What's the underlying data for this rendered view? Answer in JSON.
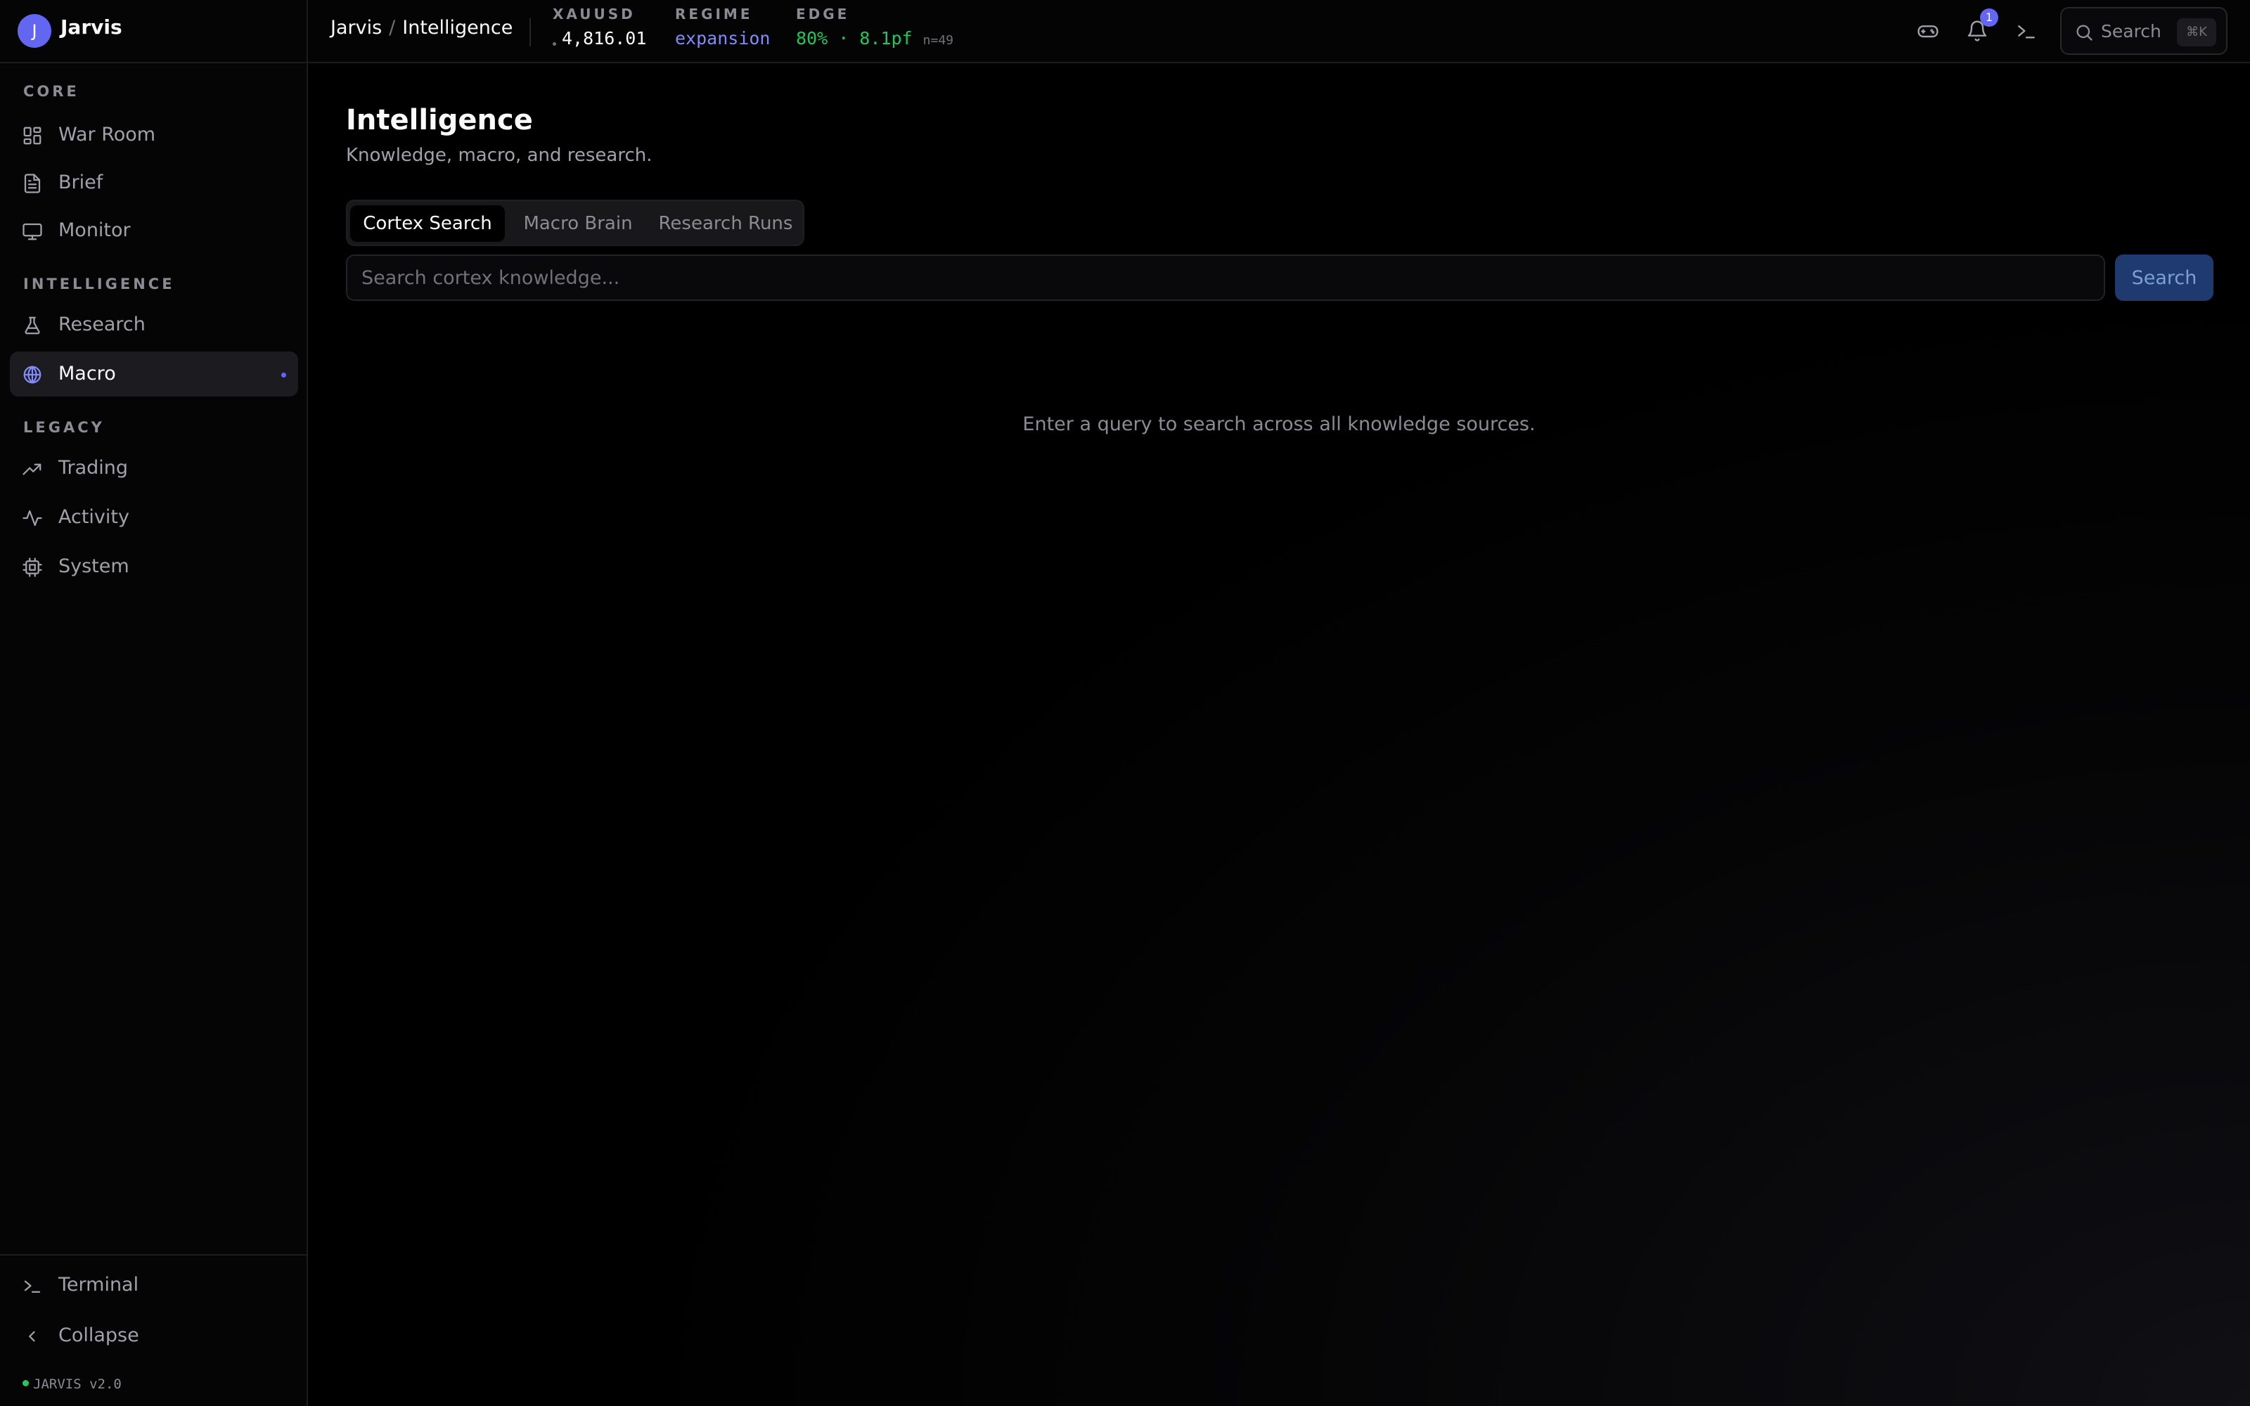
{
  "brand": {
    "avatar_letter": "J",
    "name": "Jarvis"
  },
  "sidebar": {
    "sections": {
      "core": "CORE",
      "intelligence": "INTELLIGENCE",
      "legacy": "LEGACY"
    },
    "items": [
      {
        "label": "War Room",
        "icon": "grid-icon"
      },
      {
        "label": "Brief",
        "icon": "document-icon"
      },
      {
        "label": "Monitor",
        "icon": "monitor-icon"
      },
      {
        "label": "Research",
        "icon": "flask-icon"
      },
      {
        "label": "Macro",
        "icon": "brain-icon",
        "active": true
      },
      {
        "label": "Trading",
        "icon": "trending-up-icon"
      },
      {
        "label": "Activity",
        "icon": "activity-icon"
      },
      {
        "label": "System",
        "icon": "cpu-icon"
      }
    ],
    "footer": {
      "terminal": "Terminal",
      "collapse": "Collapse",
      "version": "JARVIS v2.0"
    }
  },
  "header": {
    "breadcrumb": {
      "root": "Jarvis",
      "separator": "/",
      "current": "Intelligence"
    },
    "tickers": {
      "xauusd": {
        "label": "XAUUSD",
        "value": "4,816.01"
      },
      "regime": {
        "label": "REGIME",
        "value": "expansion"
      },
      "edge": {
        "label": "EDGE",
        "value": "80% · 8.1pf",
        "sample": "n=49"
      }
    },
    "notifications_count": "1",
    "search": {
      "label": "Search",
      "shortcut": "⌘K"
    }
  },
  "main": {
    "title": "Intelligence",
    "subtitle": "Knowledge, macro, and research.",
    "tabs": [
      {
        "label": "Cortex Search",
        "active": true
      },
      {
        "label": "Macro Brain"
      },
      {
        "label": "Research Runs"
      }
    ],
    "search": {
      "placeholder": "Search cortex knowledge...",
      "value": "",
      "button": "Search"
    },
    "empty_message": "Enter a query to search across all knowledge sources."
  },
  "colors": {
    "accent": "#6366f1",
    "regime": "#818cf8",
    "edge": "#22c55e",
    "status_dot": "#22c55e"
  }
}
